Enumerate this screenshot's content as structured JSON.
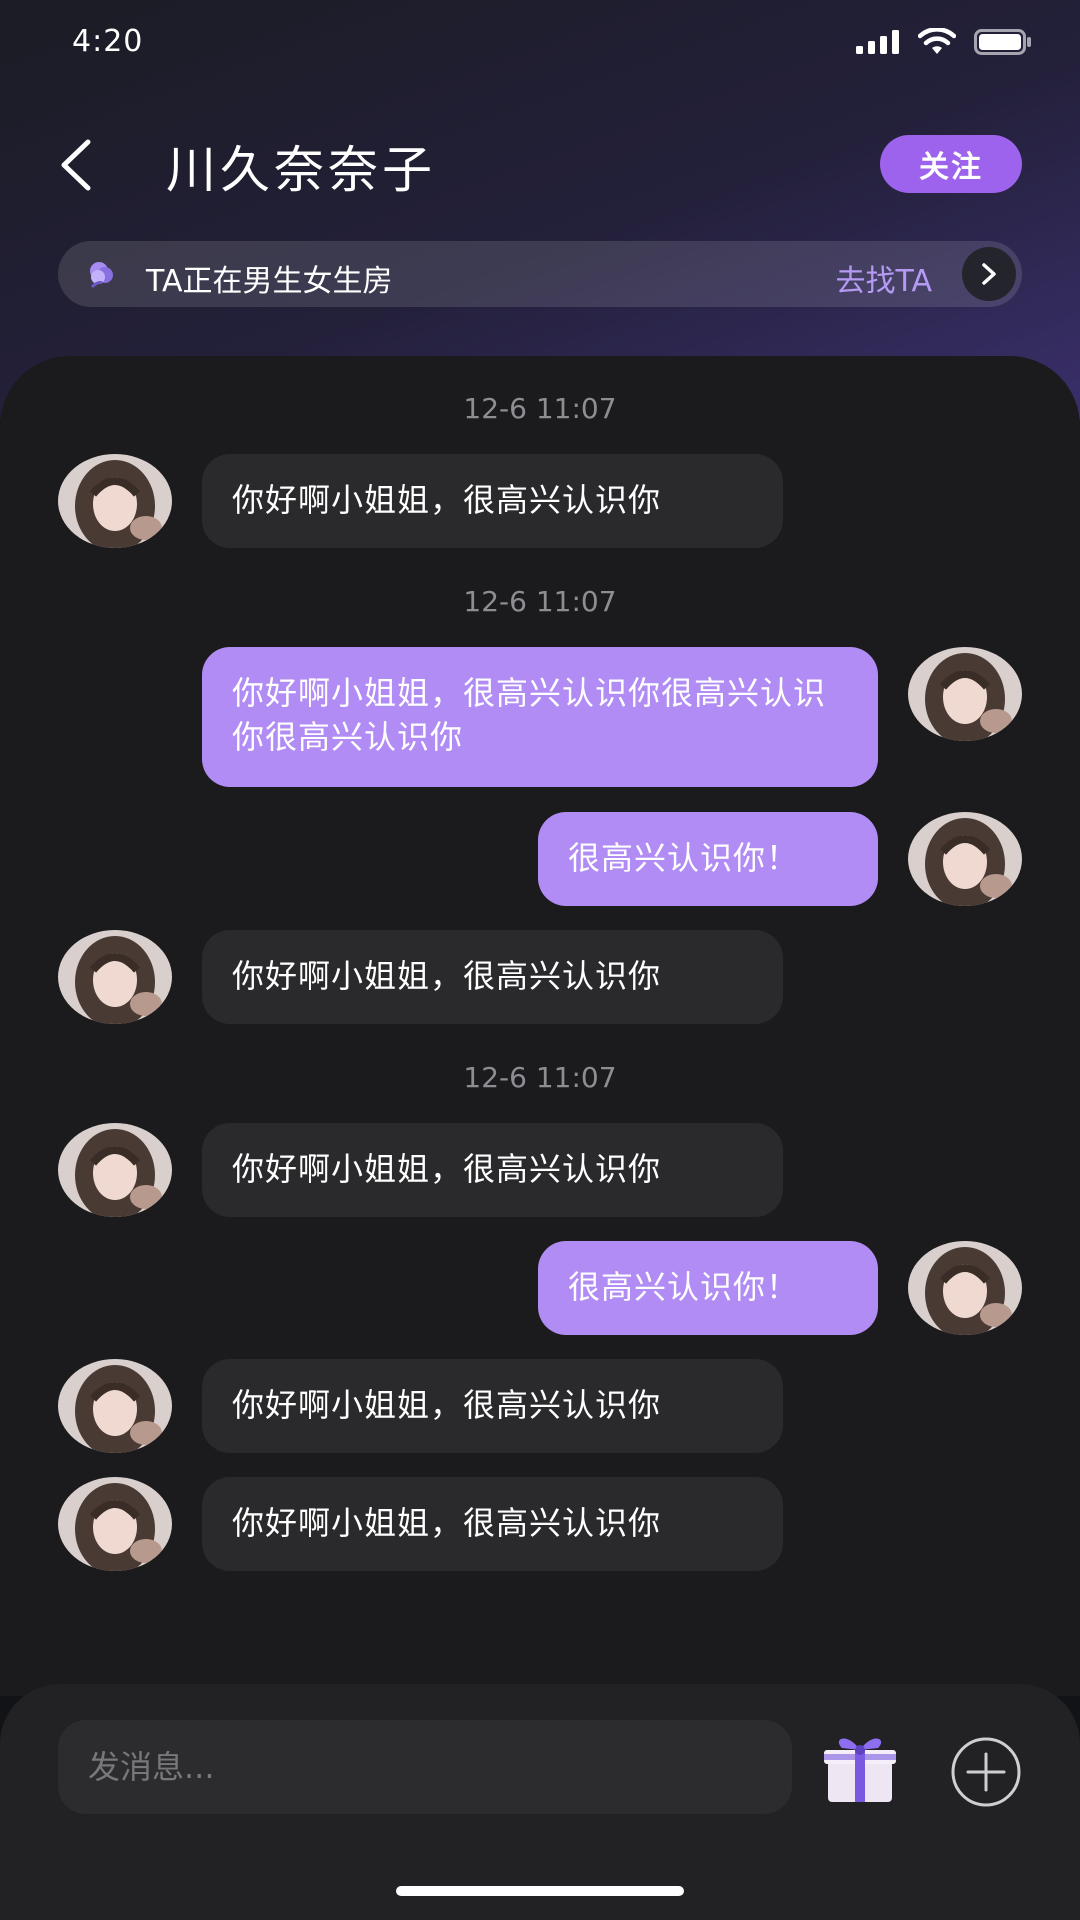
{
  "status_bar": {
    "time": "4:20"
  },
  "header": {
    "title": "川久奈奈子",
    "follow_label": "关注"
  },
  "room_banner": {
    "text": "TA正在男生女生房",
    "link": "去找TA"
  },
  "timestamps": [
    "12-6 11:07",
    "12-6 11:07",
    "12-6 11:07"
  ],
  "messages": [
    {
      "side": "in",
      "text": "你好啊小姐姐，很高兴认识你"
    },
    {
      "side": "out",
      "text": "你好啊小姐姐，很高兴认识你很高兴认识你很高兴认识你"
    },
    {
      "side": "out",
      "text": "很高兴认识你！"
    },
    {
      "side": "in",
      "text": "你好啊小姐姐，很高兴认识你"
    },
    {
      "side": "in",
      "text": "你好啊小姐姐，很高兴认识你"
    },
    {
      "side": "out",
      "text": "很高兴认识你！"
    },
    {
      "side": "in",
      "text": "你好啊小姐姐，很高兴认识你"
    },
    {
      "side": "in",
      "text": "你好啊小姐姐，很高兴认识你"
    }
  ],
  "input": {
    "placeholder": "发消息..."
  },
  "icons": {
    "back": "chevron-left-icon",
    "room": "rose-icon",
    "room_arrow": "chevron-right-icon",
    "gift": "gift-icon",
    "plus": "plus-circle-icon"
  },
  "colors": {
    "accent": "#9d63ec",
    "outgoing_bubble": "#b18cf4",
    "incoming_bubble": "#2a2a2c",
    "link": "#b59af4"
  }
}
